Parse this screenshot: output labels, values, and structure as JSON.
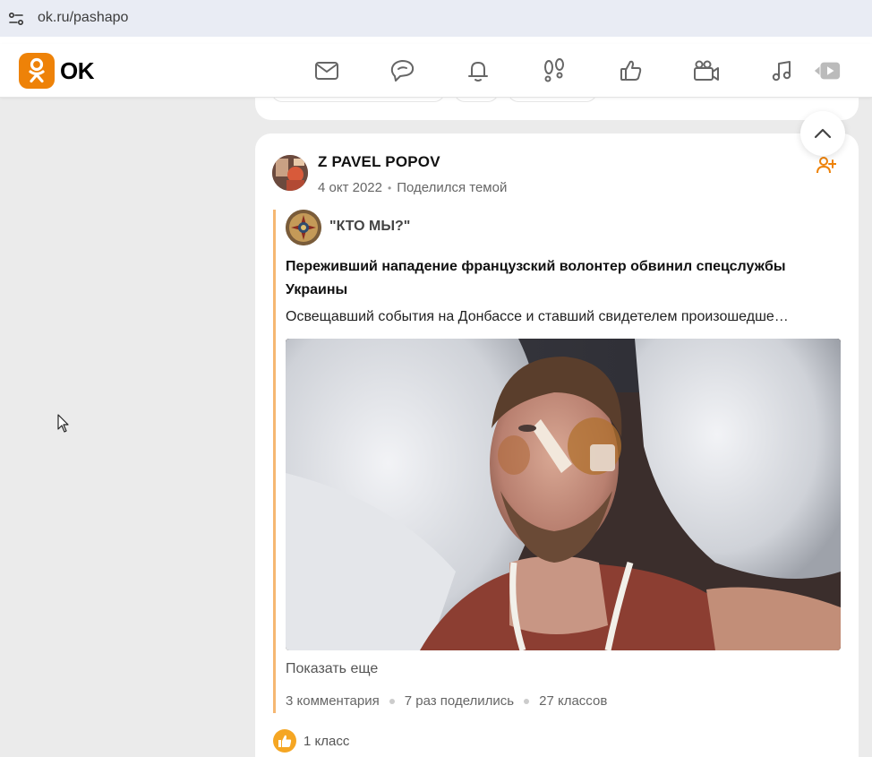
{
  "browser": {
    "url": "ok.ru/pashapo"
  },
  "site": {
    "logo_text": "OK",
    "brand_color": "#ee8208",
    "nav_icons": [
      "messages-icon",
      "discussions-icon",
      "notifications-icon",
      "guests-icon",
      "events-icon",
      "video-icon",
      "music-icon",
      "video-player-icon"
    ]
  },
  "post": {
    "author": "Z PAVEL POPOV",
    "date": "4 окт 2022",
    "action": "Поделился темой",
    "repost": {
      "group_name": "\"КТО МЫ?\"",
      "headline": "Переживший нападение французский волонтер обвинил спецслужбы Украины",
      "lead": "Освещавший события на Донбассе и ставший свидетелем произошедше…",
      "show_more": "Показать еще",
      "stats": {
        "comments": "3 комментария",
        "shares": "7 раз поделились",
        "likes": "27 классов"
      },
      "accent_color": "#f5b772"
    },
    "own_likes": "1 класс"
  }
}
